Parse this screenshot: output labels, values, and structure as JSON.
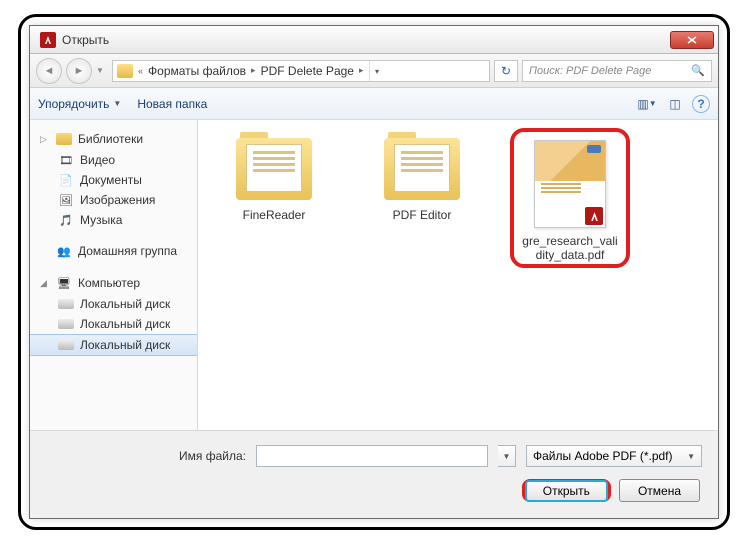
{
  "window": {
    "title": "Открыть"
  },
  "breadcrumb": {
    "seg1": "Форматы файлов",
    "seg2": "PDF Delete Page"
  },
  "search": {
    "placeholder": "Поиск: PDF Delete Page"
  },
  "toolbar": {
    "organize": "Упорядочить",
    "new_folder": "Новая папка"
  },
  "sidebar": {
    "libraries": "Библиотеки",
    "video": "Видео",
    "documents": "Документы",
    "pictures": "Изображения",
    "music": "Музыка",
    "homegroup": "Домашняя группа",
    "computer": "Компьютер",
    "disk1": "Локальный диск",
    "disk2": "Локальный диск"
  },
  "items": {
    "folder1": "FineReader",
    "folder2": "PDF Editor",
    "file1": "gre_research_validity_data.pdf"
  },
  "footer": {
    "filename_label": "Имя файла:",
    "filename_value": "",
    "filetype": "Файлы Adobe PDF (*.pdf)",
    "open": "Открыть",
    "cancel": "Отмена"
  }
}
